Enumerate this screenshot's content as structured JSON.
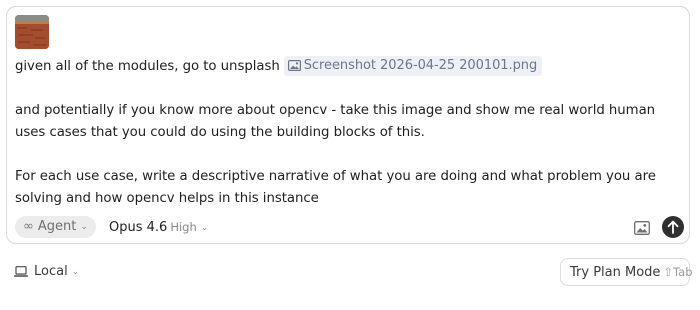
{
  "composer": {
    "message_line1": "given all of the modules, go to unsplash",
    "attachment_name": "Screenshot 2026-04-25 200101.png",
    "message_para2": "and potentially if you know more about opencv - take this image and show me real world human uses cases that you could do using the building blocks of this.",
    "message_para3": "For each use case, write a descriptive narrative of what you are doing and what problem you are solving and how opencv helps in this instance"
  },
  "toolbar": {
    "mode_icon": "infinity-icon",
    "mode_label": "Agent",
    "model_name": "Opus 4.6",
    "model_effort": "High",
    "image_icon": "image-icon",
    "send_icon": "arrow-up-icon"
  },
  "footer": {
    "location_icon": "laptop-icon",
    "location_label": "Local",
    "plan_mode_label": "Try Plan Mode",
    "plan_mode_shortcut": "⇧Tab"
  },
  "colors": {
    "send_button": "#2f2f2f",
    "chip_background": "#eef0f6",
    "chip_text": "#6a7590"
  }
}
